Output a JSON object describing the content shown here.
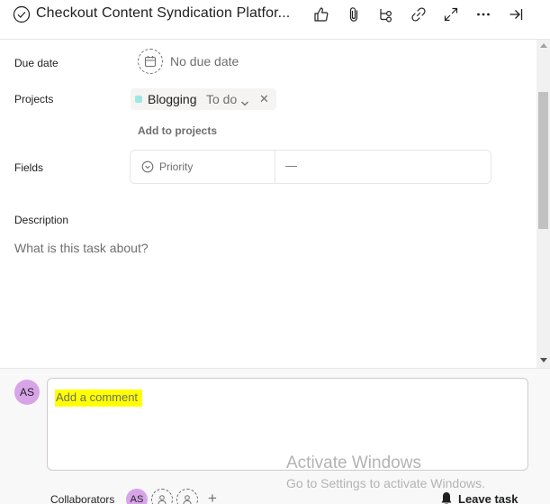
{
  "header": {
    "title": "Checkout Content Syndication Platfor...",
    "icons": [
      "check-circle-icon",
      "thumbs-up-icon",
      "paperclip-icon",
      "subtask-icon",
      "link-icon",
      "expand-icon",
      "more-icon",
      "close-panel-icon"
    ]
  },
  "fields": {
    "due_date": {
      "label": "Due date",
      "value": "No due date"
    },
    "projects": {
      "label": "Projects",
      "items": [
        {
          "name": "Blogging",
          "section": "To do",
          "color": "#9ee7e3"
        }
      ],
      "add_label": "Add to projects"
    },
    "custom": {
      "label": "Fields",
      "items": [
        {
          "name": "Priority",
          "value": "—"
        }
      ]
    },
    "description": {
      "label": "Description",
      "placeholder": "What is this task about?"
    }
  },
  "comment": {
    "avatar_initials": "AS",
    "placeholder": "Add a comment",
    "highlight_color": "#ffff00"
  },
  "collaborators": {
    "label": "Collaborators",
    "avatars": [
      "AS"
    ],
    "empty_slots": 2,
    "add_symbol": "+"
  },
  "leave_task": {
    "label": "Leave task"
  },
  "watermark": {
    "title": "Activate Windows",
    "subtitle": "Go to Settings to activate Windows."
  },
  "colors": {
    "avatar": "#d7a4e8",
    "muted_text": "#6d6e6f",
    "border": "#e6e6e6"
  }
}
